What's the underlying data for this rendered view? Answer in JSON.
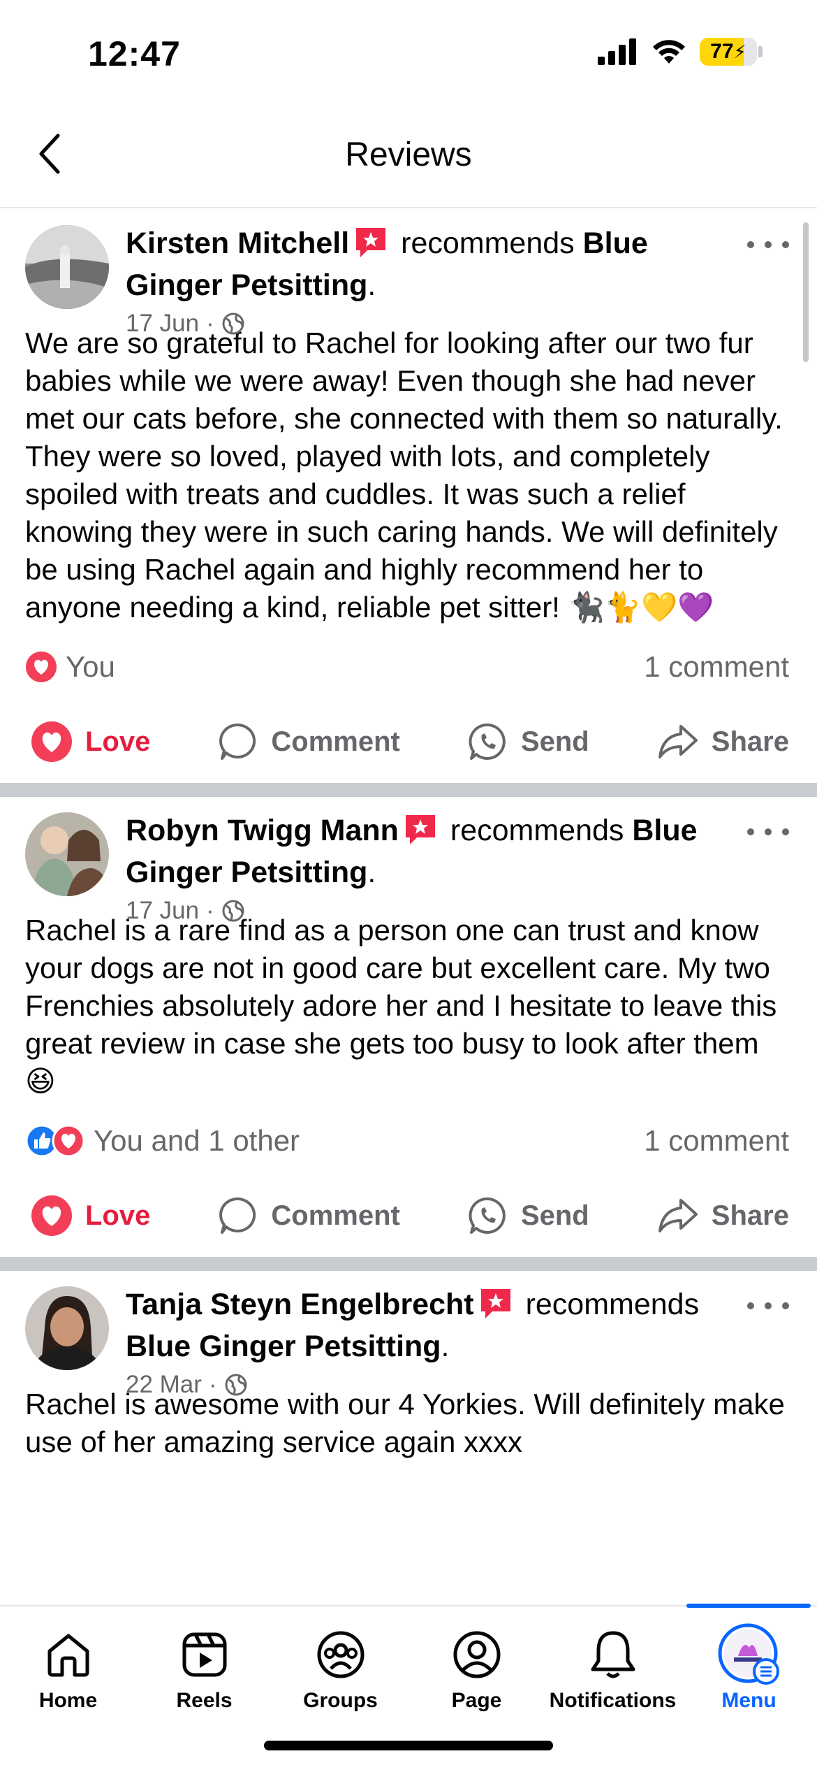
{
  "status_bar": {
    "time": "12:47",
    "battery": "77",
    "battery_level": 0.77
  },
  "header": {
    "title": "Reviews"
  },
  "posts": [
    {
      "author": "Kirsten Mitchell",
      "action_text": "recommends",
      "page": "Blue Ginger Petsitting",
      "date": "17 Jun",
      "body": "We are so grateful to Rachel for looking after our two fur babies while we were away! Even though she had never met our cats before, she connected with them so naturally. They were so loved, played with lots, and completely spoiled with treats and cuddles. It was such a relief knowing they were in such caring hands. We will definitely be using Rachel again and highly recommend her to anyone needing a kind, reliable pet sitter! 🐈‍⬛🐈💛💜",
      "reactors": "You",
      "comments": "1 comment"
    },
    {
      "author": "Robyn Twigg Mann",
      "action_text": "recommends",
      "page": "Blue Ginger Petsitting",
      "date": "17 Jun",
      "body": "Rachel is a rare find as a person one can trust and know your dogs are not in good care but excellent care.  My two Frenchies absolutely adore her and I hesitate to leave this great review in case she gets too busy to look after them 😆",
      "reactors": "You and 1 other",
      "comments": "1 comment"
    },
    {
      "author": "Tanja Steyn Engelbrecht",
      "action_text": "recommends",
      "page": "Blue Ginger Petsitting",
      "date": "22 Mar",
      "body": "Rachel is awesome with our 4 Yorkies. Will definitely make use of her amazing service again xxxx"
    }
  ],
  "actions": {
    "love": "Love",
    "comment": "Comment",
    "send": "Send",
    "share": "Share"
  },
  "nav": {
    "home": "Home",
    "reels": "Reels",
    "groups": "Groups",
    "page": "Page",
    "notifications": "Notifications",
    "menu": "Menu"
  },
  "colors": {
    "accent": "#0866ff",
    "love": "#e41e3f",
    "muted": "#65676b",
    "battery": "#ffd60a"
  }
}
